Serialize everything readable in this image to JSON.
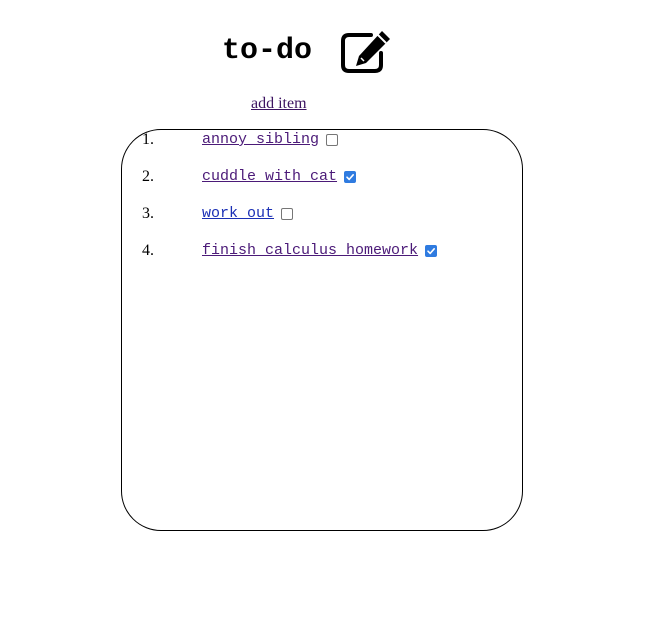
{
  "header": {
    "title": "to-do",
    "icon": "edit-icon"
  },
  "add_item_label": "add item",
  "colors": {
    "visited_link": "#4b1a78",
    "unvisited_link": "#1a2fb5",
    "checkbox_checked": "#2f7be0"
  },
  "todo_list": {
    "items": [
      {
        "number": "1.",
        "label": "annoy sibling",
        "checked": false
      },
      {
        "number": "2.",
        "label": "cuddle with cat",
        "checked": true
      },
      {
        "number": "3.",
        "label": "work out",
        "checked": false
      },
      {
        "number": "4.",
        "label": "finish calculus homework",
        "checked": true
      }
    ]
  }
}
